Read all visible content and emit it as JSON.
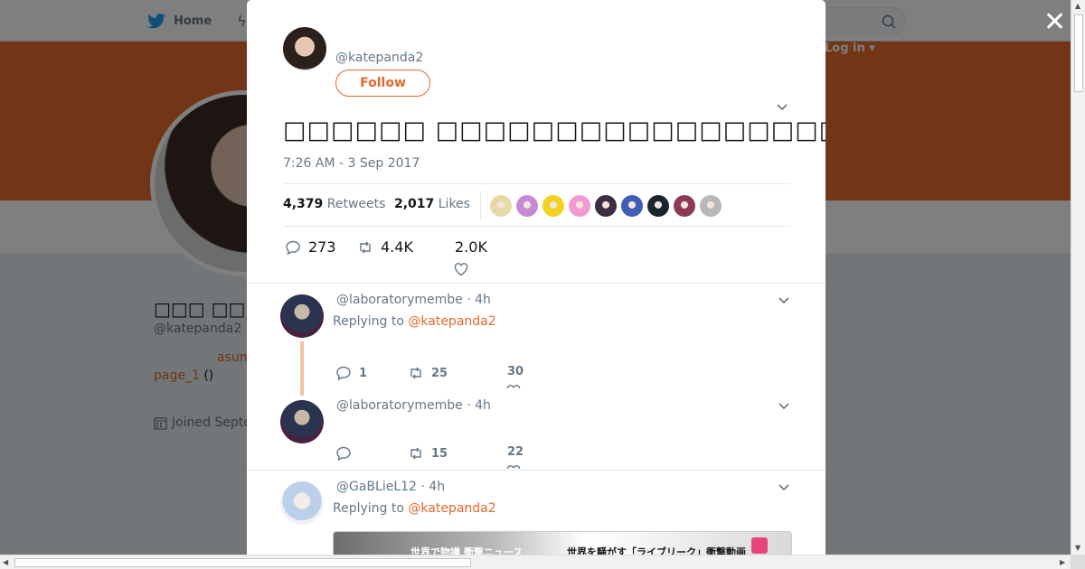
{
  "topbar": {
    "home_label": "Home",
    "login_label": "Log in ▾"
  },
  "profile": {
    "name": "□□□ □□□□",
    "handle": "@katepanda2",
    "bio_link": "asun",
    "page_link": "page_1",
    "page_suffix": " ()",
    "joined": "Joined Septe"
  },
  "modal": {
    "close_label": "✕",
    "author_handle": "@katepanda2",
    "follow_label": "Follow",
    "tweet_text": "□□□□□□ □□□□□□□□□□□□□□□□□□□□□□□□□□□□□□□□□□□□□□□□□□□□□□□□□",
    "timestamp": "7:26 AM - 3 Sep 2017",
    "retweets_count": "4,379",
    "retweets_label": "Retweets",
    "likes_count": "2,017",
    "likes_label": "Likes",
    "liker_colors": [
      "#e9d9a6",
      "#c78bd6",
      "#f2d21d",
      "#f29ad1",
      "#3b2d44",
      "#3e5fb5",
      "#1b2530",
      "#8c3a52",
      "#b8b8b8"
    ],
    "reply_count": "273",
    "retweet_count": "4.4K",
    "like_count": "2.0K"
  },
  "replies": [
    {
      "handle": "@laboratorymembe · 4h",
      "replying_prefix": "Replying to ",
      "replying_to": "@katepanda2",
      "reply_count": "1",
      "retweet_count": "25",
      "like_count": "30"
    },
    {
      "handle": "@laboratorymembe · 4h",
      "reply_count": "",
      "retweet_count": "15",
      "like_count": "22"
    },
    {
      "handle": "@GaBLieL12 · 4h",
      "replying_prefix": "Replying to ",
      "replying_to": "@katepanda2",
      "media_caption_left": "世界で物議 衝撃ニュース",
      "media_caption_right": "世界を騒がす「ライブリーク」衝撃動画"
    }
  ],
  "colors": {
    "accent": "#e0682a",
    "banner": "#e46b2b"
  }
}
